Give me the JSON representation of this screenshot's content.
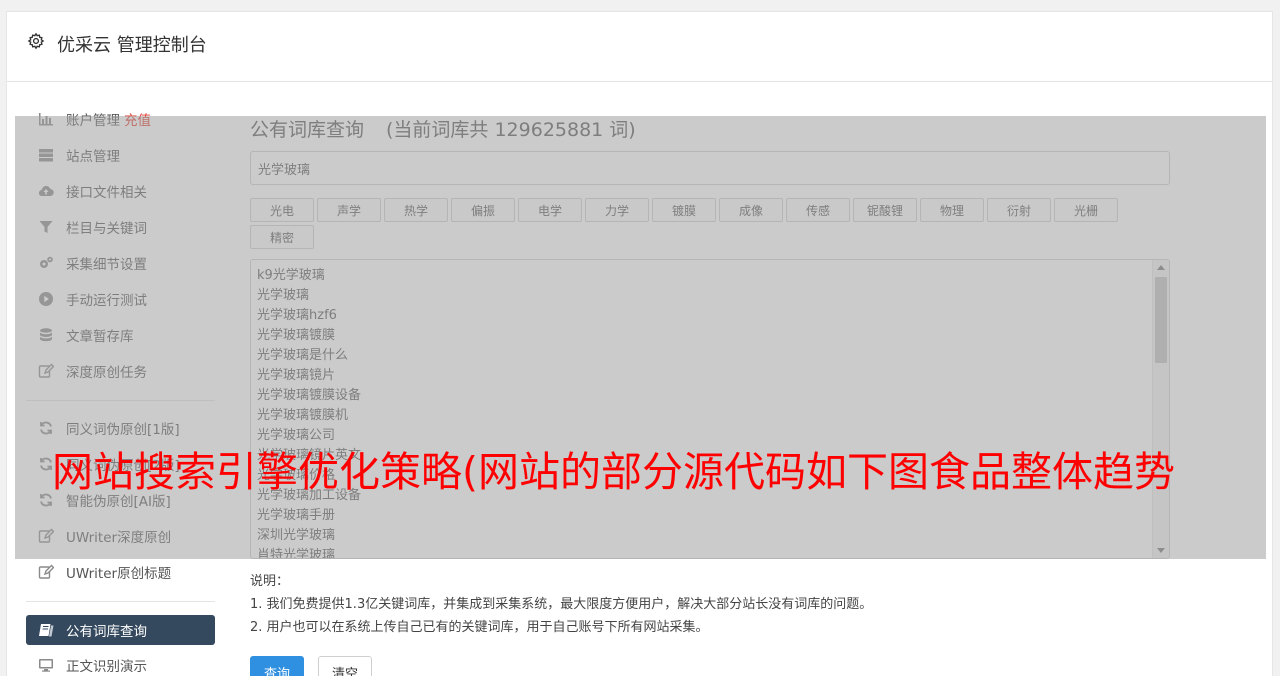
{
  "header": {
    "title": "优采云 管理控制台"
  },
  "sidebar": {
    "items": [
      {
        "label": "账户管理",
        "extra": "充值",
        "icon": "bar-chart-icon"
      },
      {
        "label": "站点管理",
        "icon": "server-icon"
      },
      {
        "label": "接口文件相关",
        "icon": "cloud-upload-icon"
      },
      {
        "label": "栏目与关键词",
        "icon": "filter-icon"
      },
      {
        "label": "采集细节设置",
        "icon": "gears-icon"
      },
      {
        "label": "手动运行测试",
        "icon": "play-circle-icon"
      },
      {
        "label": "文章暂存库",
        "icon": "database-icon"
      },
      {
        "label": "深度原创任务",
        "icon": "edit-icon"
      },
      {
        "label": "同义词伪原创[1版]",
        "icon": "refresh-icon"
      },
      {
        "label": "同义词伪原创[2版]",
        "icon": "refresh-icon"
      },
      {
        "label": "智能伪原创[AI版]",
        "icon": "refresh-icon"
      },
      {
        "label": "UWriter深度原创",
        "icon": "edit-icon"
      },
      {
        "label": "UWriter原创标题",
        "icon": "edit-icon"
      },
      {
        "label": "公有词库查询",
        "icon": "book-icon"
      },
      {
        "label": "正文识别演示",
        "icon": "monitor-icon"
      }
    ]
  },
  "main": {
    "heading": "公有词库查询",
    "subheading": "(当前词库共 129625881 词)",
    "search_value": "光学玻璃",
    "tags": [
      "光电",
      "声学",
      "热学",
      "偏振",
      "电学",
      "力学",
      "镀膜",
      "成像",
      "传感",
      "铌酸锂",
      "物理",
      "衍射",
      "光栅",
      "精密"
    ],
    "results": [
      "k9光学玻璃",
      "光学玻璃",
      "光学玻璃hzf6",
      "光学玻璃镀膜",
      "光学玻璃是什么",
      "光学玻璃镜片",
      "光学玻璃镀膜设备",
      "光学玻璃镀膜机",
      "光学玻璃公司",
      "光学玻璃镜片英文",
      "光学玻璃价格",
      "光学玻璃加工设备",
      "光学玻璃手册",
      "深圳光学玻璃",
      "肖特光学玻璃"
    ],
    "notes_title": "说明：",
    "notes": [
      "1. 我们免费提供1.3亿关键词库，并集成到采集系统，最大限度方便用户，解决大部分站长没有词库的问题。",
      "2. 用户也可以在系统上传自己已有的关键词库，用于自己账号下所有网站采集。"
    ],
    "query_button": "查询",
    "clear_button": "清空"
  },
  "overlay_headline": "网站搜索引擎优化策略(网站的部分源代码如下图食品整体趋势"
}
